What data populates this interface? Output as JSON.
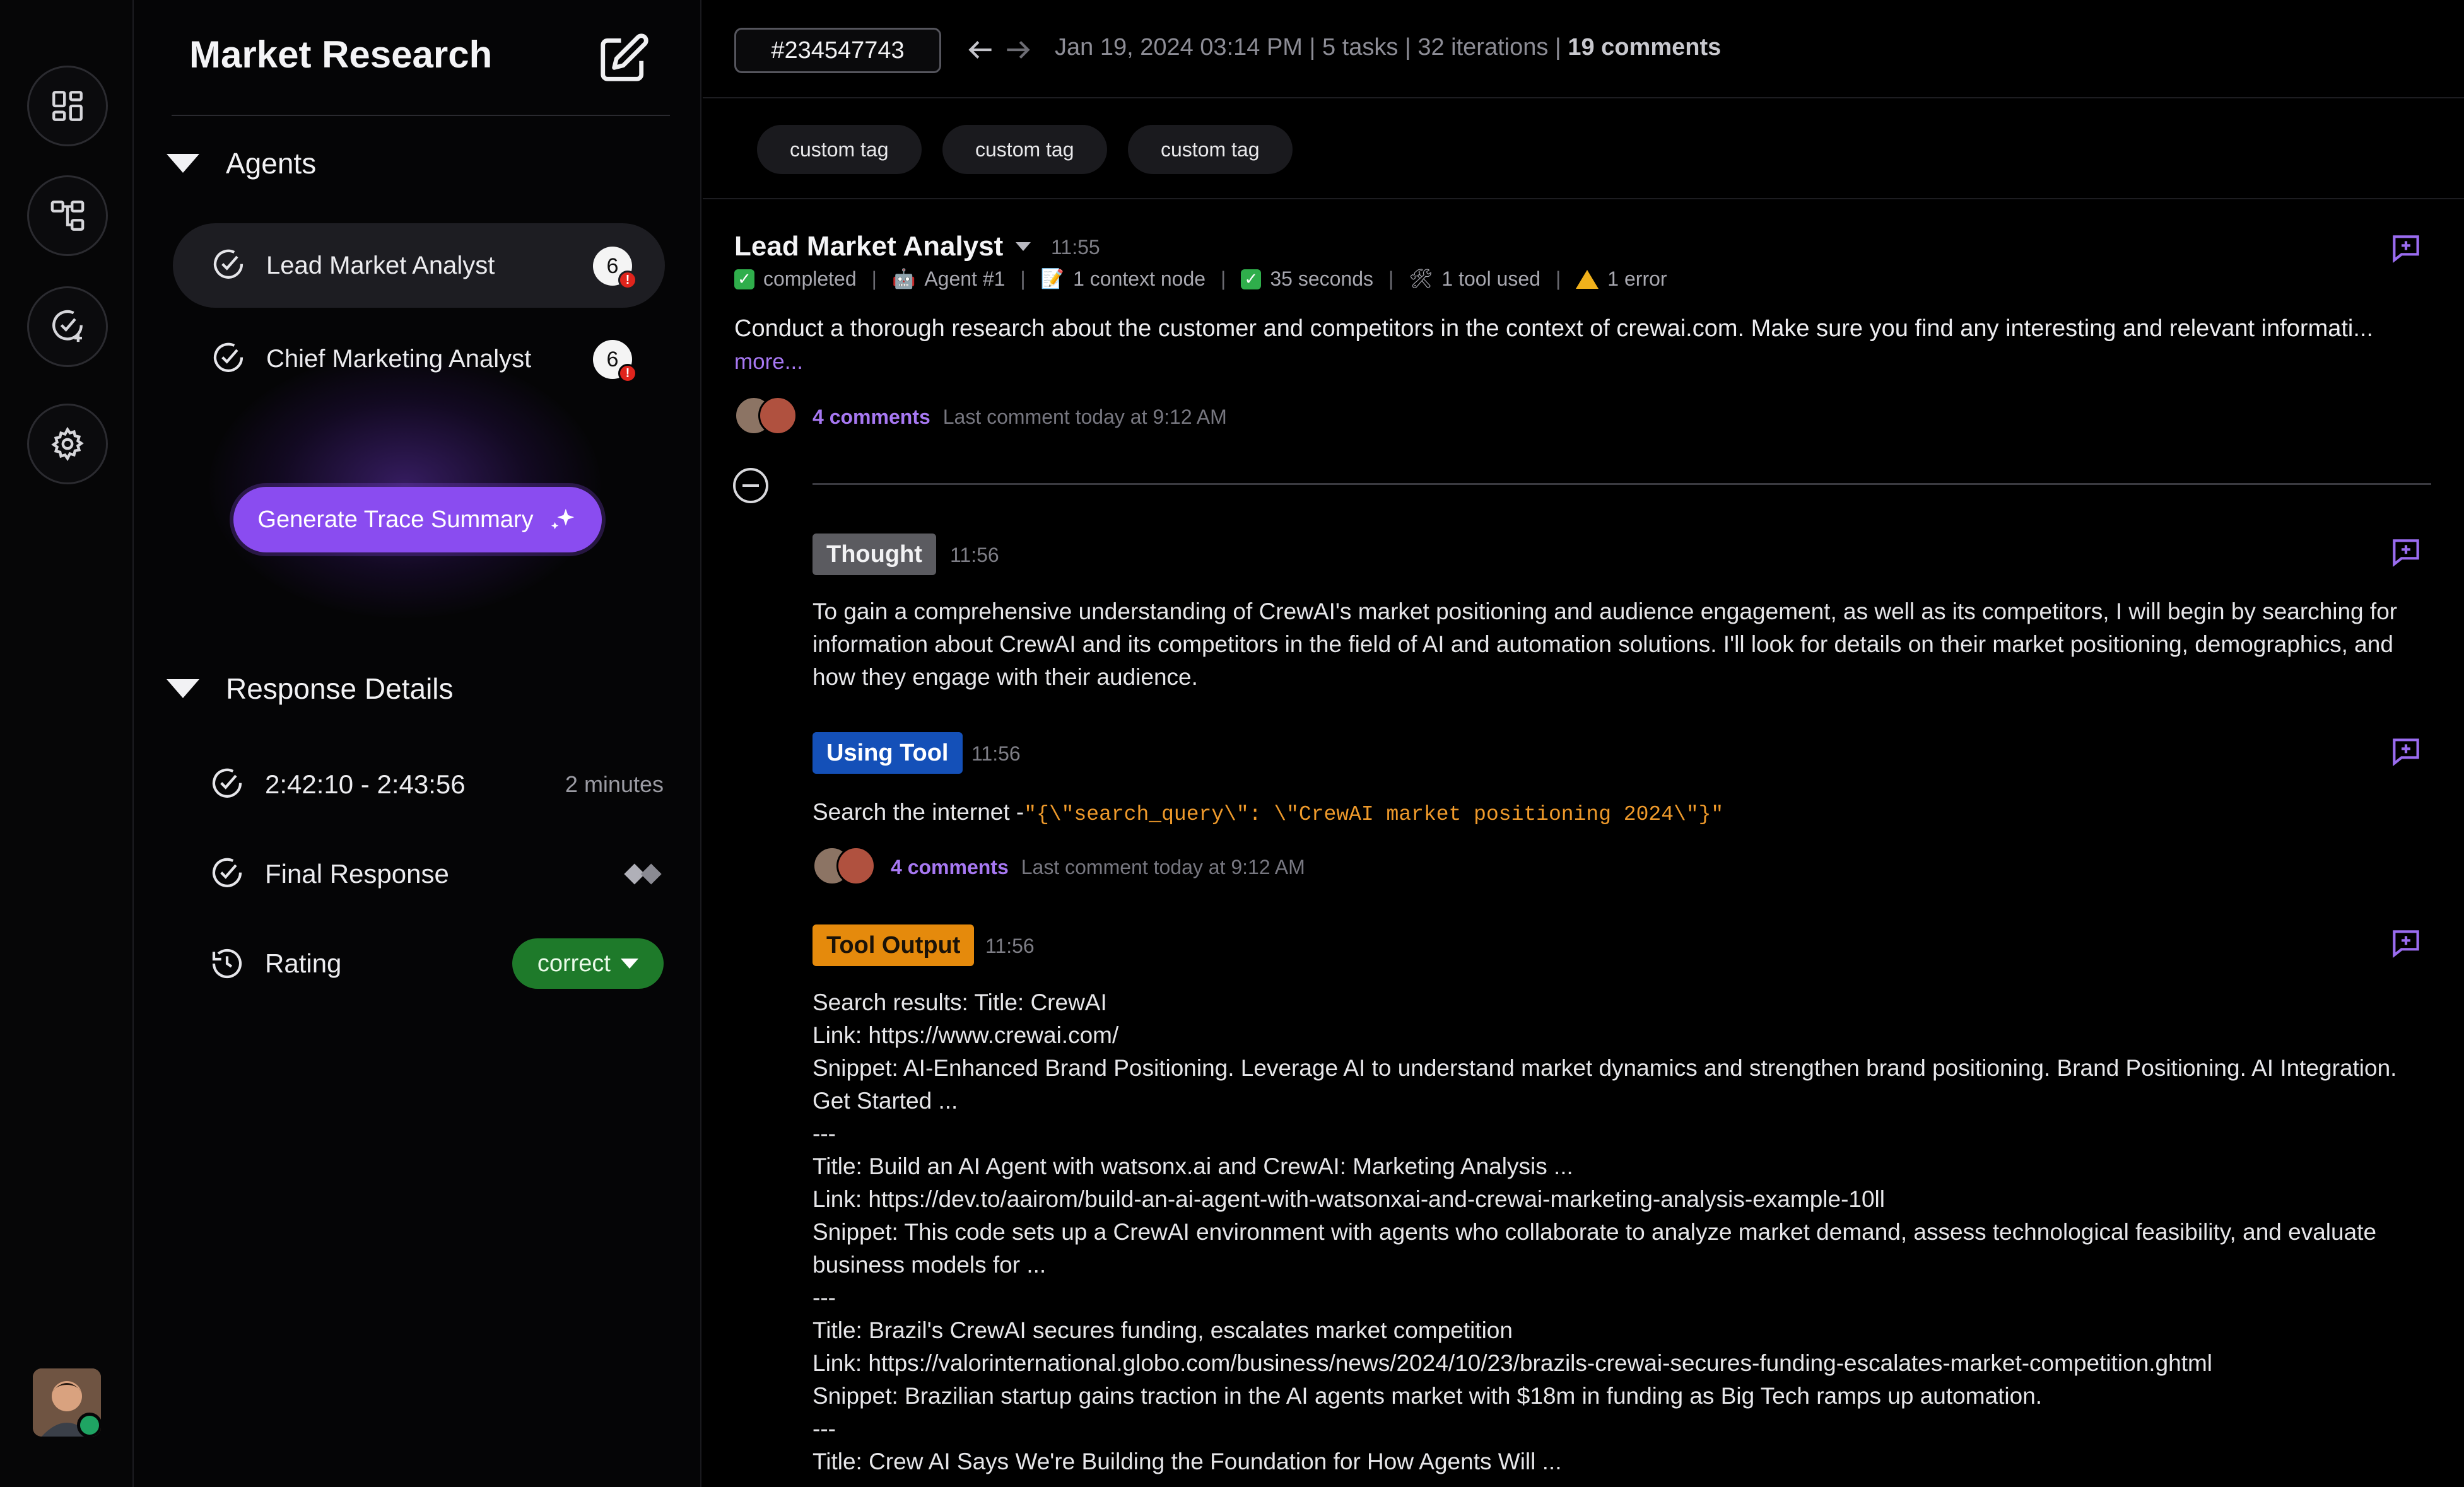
{
  "sidebar": {
    "title": "Market Research",
    "agents_heading": "Agents",
    "agents": [
      {
        "label": "Lead Market Analyst",
        "badge": "6",
        "alert": "!"
      },
      {
        "label": "Chief Marketing Analyst",
        "badge": "6",
        "alert": "!"
      }
    ],
    "generate_button": "Generate Trace Summary",
    "response_heading": "Response Details",
    "details": {
      "time_range": "2:42:10 - 2:43:56",
      "duration": "2 minutes",
      "final_response": "Final Response",
      "rating_label": "Rating",
      "rating_value": "correct"
    }
  },
  "header": {
    "trace_id": "#234547743",
    "date": "Jan 19, 2024 03:14 PM",
    "tasks": "5 tasks",
    "iterations": "32 iterations",
    "comments": "19 comments",
    "separator": "|"
  },
  "tags": [
    "custom tag",
    "custom tag",
    "custom tag"
  ],
  "task": {
    "agent_name": "Lead Market Analyst",
    "time": "11:55",
    "status": "completed",
    "agent": "Agent #1",
    "context": "1 context node",
    "duration": "35 seconds",
    "tools": "1 tool used",
    "errors": "1 error",
    "description": "Conduct a thorough research about the customer and competitors in the context of crewai.com. Make sure you find any interesting and relevant informati...",
    "more": "more...",
    "comments_count": "4 comments",
    "last_comment": "Last comment today at 9:12 AM"
  },
  "steps": {
    "thought": {
      "label": "Thought",
      "time": "11:56",
      "text": "To gain a comprehensive understanding of CrewAI's market positioning and audience engagement, as well as its competitors, I will begin by searching for information about CrewAI and its competitors in the field of AI and automation solutions. I'll look for details on their market positioning, demographics, and how they engage with their audience."
    },
    "tool": {
      "label": "Using Tool",
      "time": "11:56",
      "prefix": "Search the internet -",
      "code": "\"{\\\"search_query\\\": \\\"CrewAI market positioning 2024\\\"}\"",
      "comments_count": "4 comments",
      "last_comment": "Last comment today at 9:12 AM"
    },
    "output": {
      "label": "Tool Output",
      "time": "11:56",
      "lines": [
        "Search results: Title: CrewAI",
        "Link: https://www.crewai.com/",
        "Snippet: AI-Enhanced Brand Positioning. Leverage AI to understand market dynamics and strengthen brand positioning. Brand Positioning. AI Integration. Get Started ...",
        "---",
        "Title: Build an AI Agent with watsonx.ai and CrewAI: Marketing Analysis ...",
        "Link: https://dev.to/aairom/build-an-ai-agent-with-watsonxai-and-crewai-marketing-analysis-example-10ll",
        "Snippet: This code sets up a CrewAI environment with agents who collaborate to analyze market demand, assess technological feasibility, and evaluate business models for ...",
        "---",
        "Title: Brazil's CrewAI secures funding, escalates market competition",
        "Link: https://valorinternational.globo.com/business/news/2024/10/23/brazils-crewai-secures-funding-escalates-market-competition.ghtml",
        "Snippet: Brazilian startup gains traction in the AI agents market with $18m in funding as Big Tech ramps up automation.",
        "---",
        "Title: Crew AI Says We're Building the Foundation for How Agents Will ..."
      ]
    }
  },
  "colors": {
    "accent": "#8a4cf0",
    "thought": "#5b5b60",
    "tool": "#1450b8",
    "output": "#e58a0c",
    "rating": "#1e7a2a",
    "link": "#a778f2"
  }
}
